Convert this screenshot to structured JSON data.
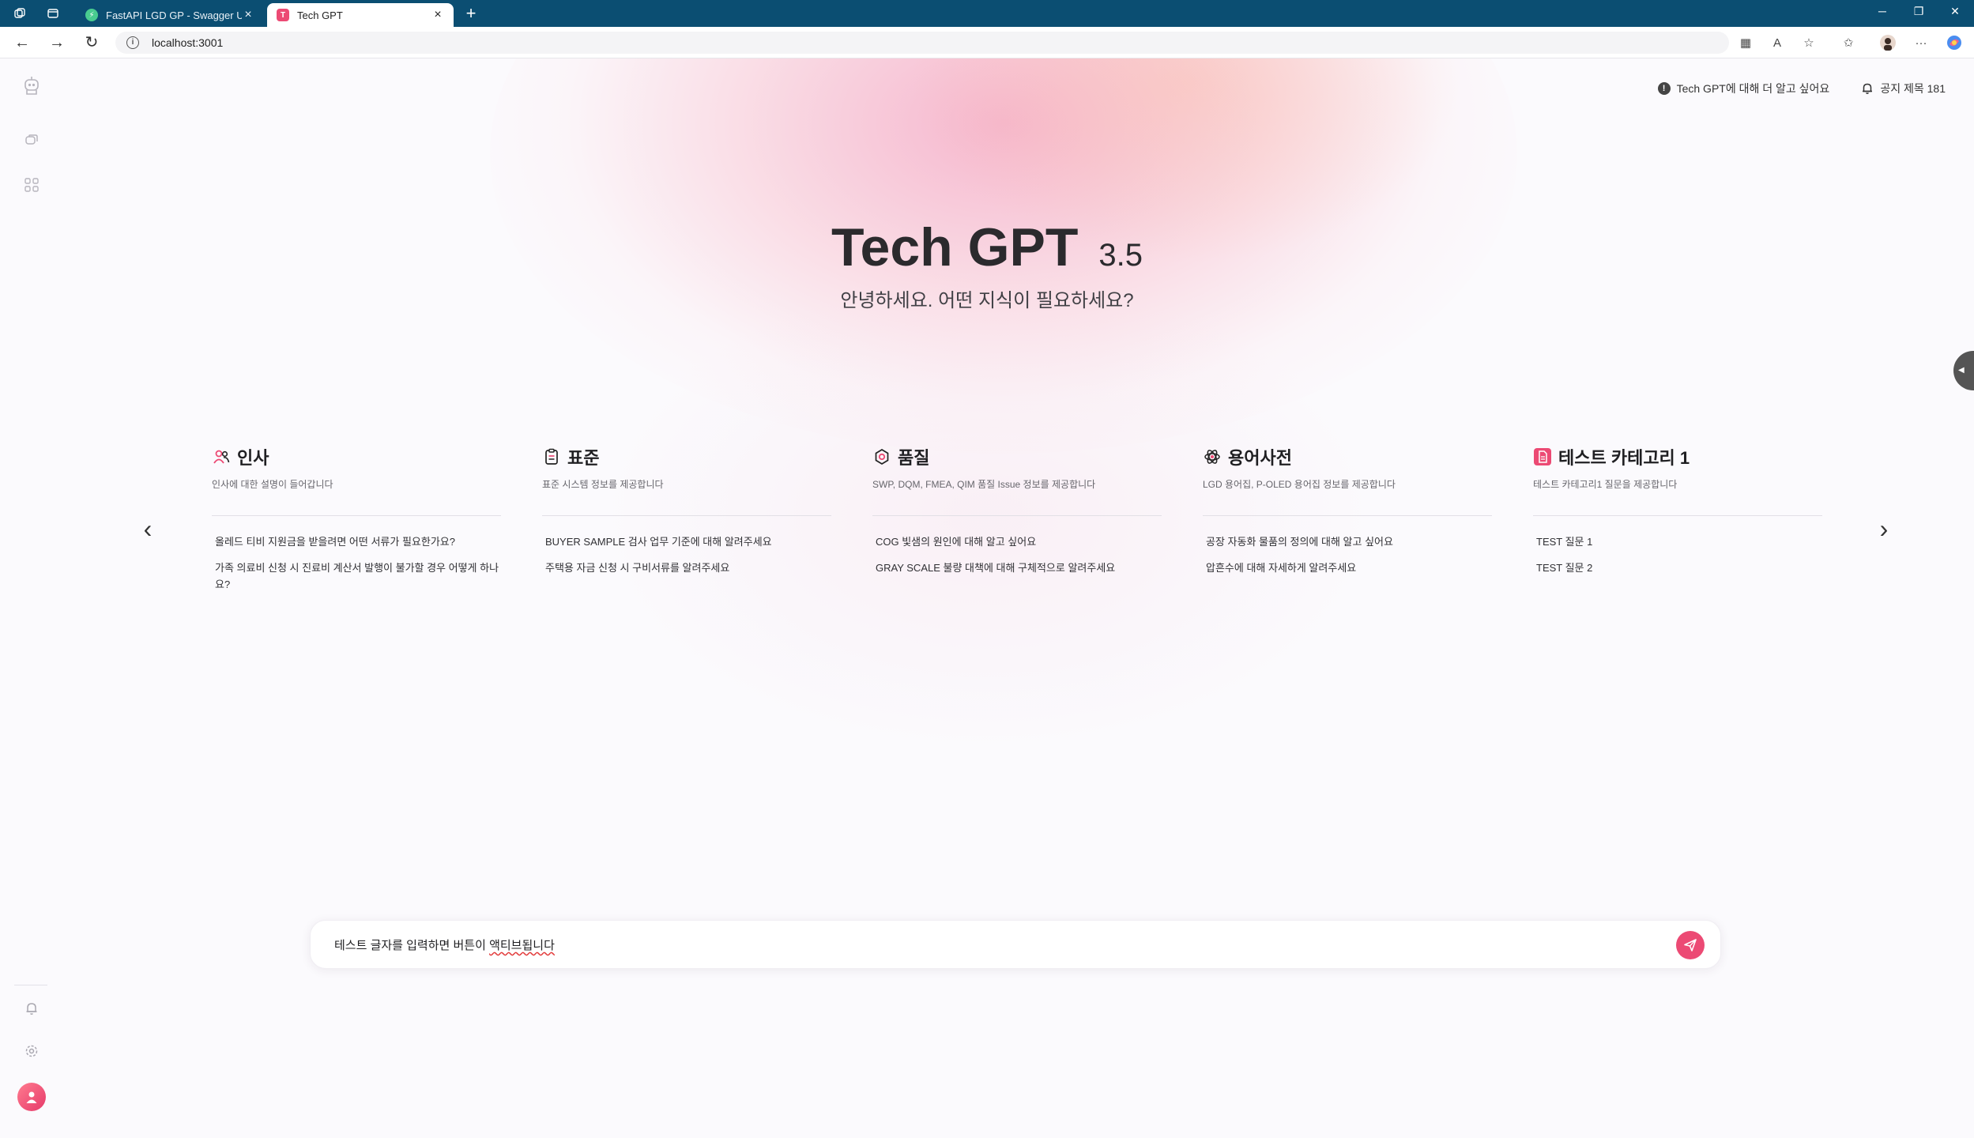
{
  "browser": {
    "tabs": [
      {
        "title": "FastAPI LGD GP - Swagger UI",
        "active": false
      },
      {
        "title": "Tech GPT",
        "active": true
      }
    ],
    "url": "localhost:3001"
  },
  "header": {
    "about_link": "Tech GPT에 대해 더 알고 싶어요",
    "notice_link": "공지 제목 181"
  },
  "hero": {
    "title": "Tech GPT",
    "version": "3.5",
    "subtitle": "안녕하세요. 어떤 지식이 필요하세요?"
  },
  "categories": [
    {
      "name": "인사",
      "icon": "people-icon",
      "description": "인사에 대한 설명이 들어갑니다",
      "questions": [
        "올레드 티비 지원금을 받을려면 어떤 서류가 필요한가요?",
        "가족 의료비 신청 시 진료비 계산서 발행이 불가할 경우 어떻게 하나요?"
      ]
    },
    {
      "name": "표준",
      "icon": "clipboard-icon",
      "description": "표준 시스템 정보를 제공합니다",
      "questions": [
        "BUYER SAMPLE 검사 업무 기준에 대해 알려주세요",
        "주택용 자금 신청 시 구비서류를 알려주세요"
      ]
    },
    {
      "name": "품질",
      "icon": "quality-badge-icon",
      "description": "SWP, DQM, FMEA, QIM 품질 Issue 정보를 제공합니다",
      "questions": [
        "COG 빛샘의 원인에 대해 알고 싶어요",
        "GRAY SCALE 불량 대책에 대해 구체적으로 알려주세요"
      ]
    },
    {
      "name": "용어사전",
      "icon": "atom-icon",
      "description": "LGD 용어집, P-OLED 용어집 정보를 제공합니다",
      "questions": [
        "공장 자동화 물품의 정의에 대해 알고 싶어요",
        "압흔수에 대해 자세하게 알려주세요"
      ]
    },
    {
      "name": "테스트 카테고리 1",
      "icon": "document-icon",
      "description": "테스트 카테고리1 질문을 제공합니다",
      "questions": [
        "TEST 질문 1",
        "TEST 질문 2"
      ]
    }
  ],
  "chat_input": {
    "value_prefix": "테스트 글자를 입력하면 버튼이 ",
    "value_misspelled": "액티브됩니다"
  },
  "colors": {
    "accent": "#ec4a74",
    "tabbar": "#0b4e72",
    "background": "#fbfafd"
  }
}
